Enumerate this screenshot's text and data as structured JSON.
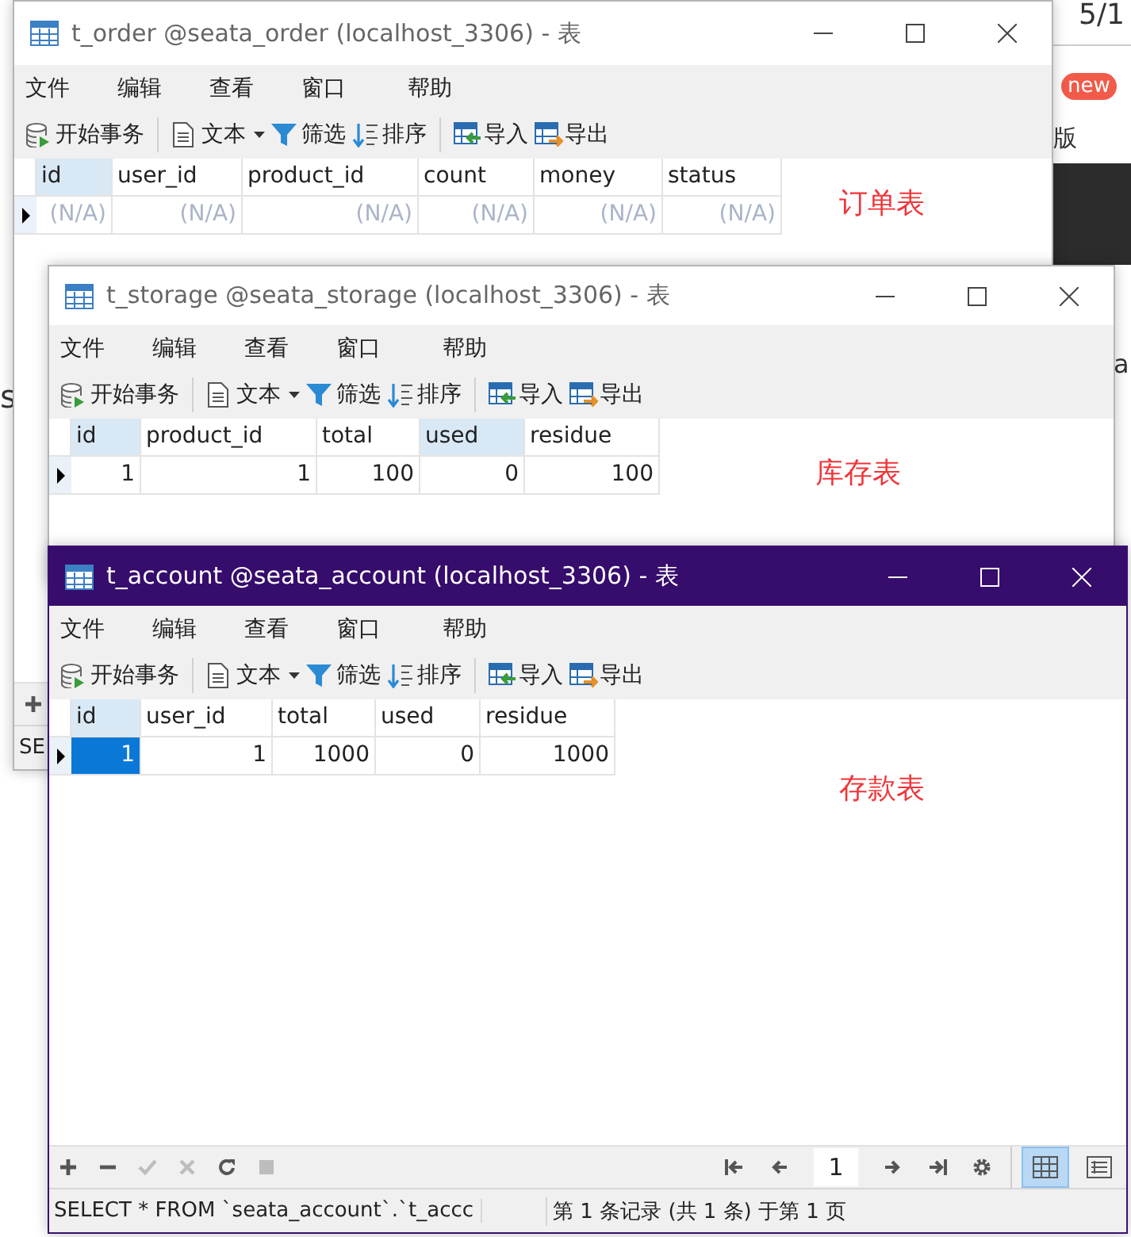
{
  "background": {
    "date": "5/1",
    "badge": "new",
    "glyph": "版",
    "fragment_right": "a",
    "fragment_left": "s"
  },
  "windows": [
    {
      "title": "t_order @seata_order (localhost_3306) - 表",
      "active": false,
      "menu": [
        "文件",
        "编辑",
        "查看",
        "窗口",
        "帮助"
      ],
      "toolbar": [
        {
          "kind": "begin",
          "label": "开始事务"
        },
        {
          "kind": "text",
          "label": "文本"
        },
        {
          "kind": "filter",
          "label": "筛选"
        },
        {
          "kind": "sort",
          "label": "排序"
        },
        {
          "kind": "import",
          "label": "导入"
        },
        {
          "kind": "export",
          "label": "导出"
        }
      ],
      "columns": [
        {
          "label": "id",
          "selected": true
        },
        {
          "label": "user_id",
          "selected": false
        },
        {
          "label": "product_id",
          "selected": false
        },
        {
          "label": "count",
          "selected": false
        },
        {
          "label": "money",
          "selected": false
        },
        {
          "label": "status",
          "selected": false
        }
      ],
      "rows": [
        {
          "cells": [
            {
              "text": "(N/A)",
              "null": true,
              "selected": false
            },
            {
              "text": "(N/A)",
              "null": true,
              "selected": false
            },
            {
              "text": "(N/A)",
              "null": true,
              "selected": false
            },
            {
              "text": "(N/A)",
              "null": true,
              "selected": false
            },
            {
              "text": "(N/A)",
              "null": true,
              "selected": false
            },
            {
              "text": "(N/A)",
              "null": true,
              "selected": false
            }
          ]
        }
      ],
      "note": "订单表",
      "bottom_tools": [
        {
          "kind": "add",
          "disabled": false
        }
      ],
      "status": {
        "sql": "SE"
      }
    },
    {
      "title": "t_storage @seata_storage (localhost_3306) - 表",
      "active": false,
      "menu": [
        "文件",
        "编辑",
        "查看",
        "窗口",
        "帮助"
      ],
      "toolbar": [
        {
          "kind": "begin",
          "label": "开始事务"
        },
        {
          "kind": "text",
          "label": "文本"
        },
        {
          "kind": "filter",
          "label": "筛选"
        },
        {
          "kind": "sort",
          "label": "排序"
        },
        {
          "kind": "import",
          "label": "导入"
        },
        {
          "kind": "export",
          "label": "导出"
        }
      ],
      "columns": [
        {
          "label": "id",
          "selected": true
        },
        {
          "label": "product_id",
          "selected": false
        },
        {
          "label": "total",
          "selected": false
        },
        {
          "label": "used",
          "selected": true
        },
        {
          "label": "residue",
          "selected": false
        }
      ],
      "rows": [
        {
          "cells": [
            {
              "text": "1",
              "null": false,
              "selected": false
            },
            {
              "text": "1",
              "null": false,
              "selected": false
            },
            {
              "text": "100",
              "null": false,
              "selected": false
            },
            {
              "text": "0",
              "null": false,
              "selected": false
            },
            {
              "text": "100",
              "null": false,
              "selected": false
            }
          ]
        }
      ],
      "note": "库存表"
    },
    {
      "title": "t_account @seata_account (localhost_3306) - 表",
      "active": true,
      "menu": [
        "文件",
        "编辑",
        "查看",
        "窗口",
        "帮助"
      ],
      "toolbar": [
        {
          "kind": "begin",
          "label": "开始事务"
        },
        {
          "kind": "text",
          "label": "文本"
        },
        {
          "kind": "filter",
          "label": "筛选"
        },
        {
          "kind": "sort",
          "label": "排序"
        },
        {
          "kind": "import",
          "label": "导入"
        },
        {
          "kind": "export",
          "label": "导出"
        }
      ],
      "columns": [
        {
          "label": "id",
          "selected": true
        },
        {
          "label": "user_id",
          "selected": false
        },
        {
          "label": "total",
          "selected": false
        },
        {
          "label": "used",
          "selected": false
        },
        {
          "label": "residue",
          "selected": false
        }
      ],
      "rows": [
        {
          "cells": [
            {
              "text": "1",
              "null": false,
              "selected": true
            },
            {
              "text": "1",
              "null": false,
              "selected": false
            },
            {
              "text": "1000",
              "null": false,
              "selected": false
            },
            {
              "text": "0",
              "null": false,
              "selected": false
            },
            {
              "text": "1000",
              "null": false,
              "selected": false
            }
          ]
        }
      ],
      "note": "存款表",
      "bottom_tools": [
        {
          "kind": "add",
          "disabled": false
        },
        {
          "kind": "remove",
          "disabled": false
        },
        {
          "kind": "apply",
          "disabled": true
        },
        {
          "kind": "discard",
          "disabled": true
        },
        {
          "kind": "refresh",
          "disabled": false
        },
        {
          "kind": "stop",
          "disabled": true
        }
      ],
      "pager": {
        "page": "1"
      },
      "views": [
        {
          "kind": "grid",
          "selected": true
        },
        {
          "kind": "form",
          "selected": false
        }
      ],
      "status": {
        "sql": "SELECT * FROM `seata_account`.`t_accc",
        "records": "第 1 条记录 (共 1 条) 于第 1 页"
      }
    }
  ]
}
